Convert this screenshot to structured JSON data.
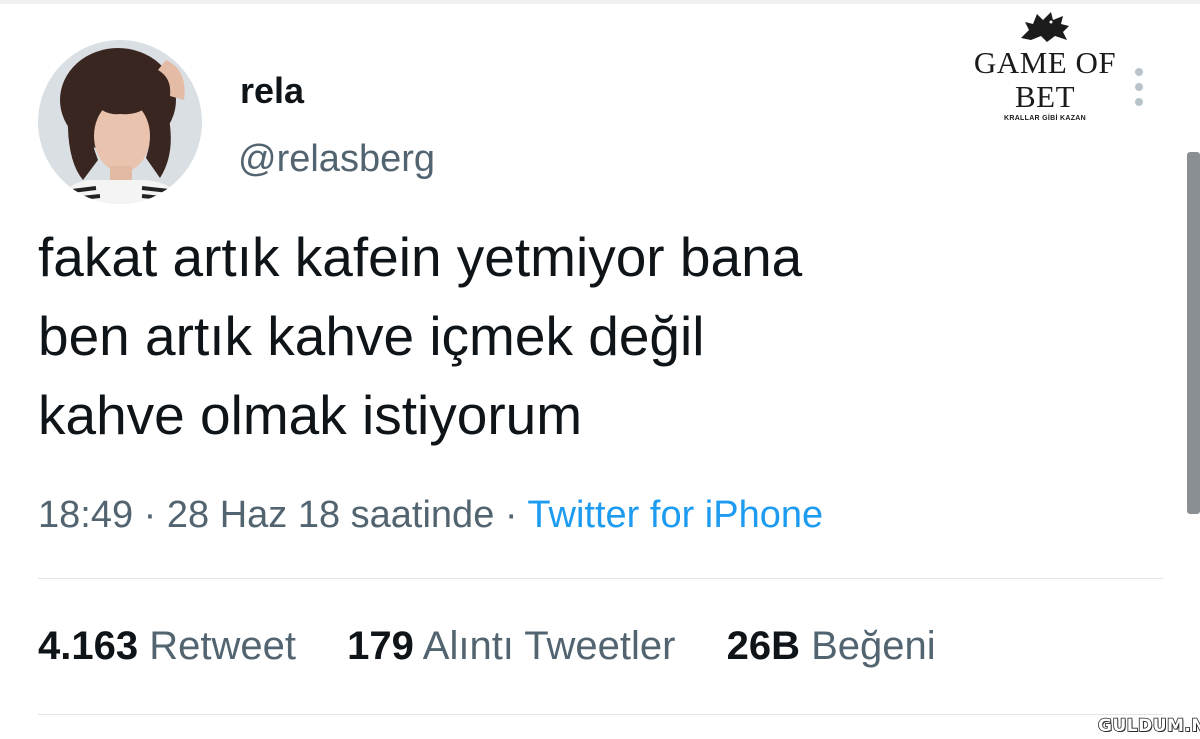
{
  "tweet": {
    "display_name": "rela",
    "handle": "@relasberg",
    "text_lines": [
      "fakat artık kafein yetmiyor bana",
      "ben artık kahve içmek değil",
      "kahve olmak istiyorum"
    ],
    "time": "18:49",
    "separator": " · ",
    "date": "28 Haz 18 saatinde",
    "source": "Twitter for iPhone",
    "stats": {
      "retweets": {
        "count": "4.163",
        "label": "Retweet"
      },
      "quotes": {
        "count": "179",
        "label": "Alıntı Tweetler"
      },
      "likes": {
        "count": "26B",
        "label": "Beğeni"
      }
    }
  },
  "watermark": {
    "brand": "GAME OF BET",
    "tagline": "KRALLAR GİBİ KAZAN",
    "icon": "wolf-icon"
  },
  "site_badge": "GULDUM.NET",
  "icons": {
    "more": "more-vertical-icon",
    "avatar": "avatar"
  },
  "colors": {
    "text_primary": "#0f1419",
    "text_secondary": "#536471",
    "link": "#1d9bf0",
    "divider": "#e1e6ea"
  }
}
